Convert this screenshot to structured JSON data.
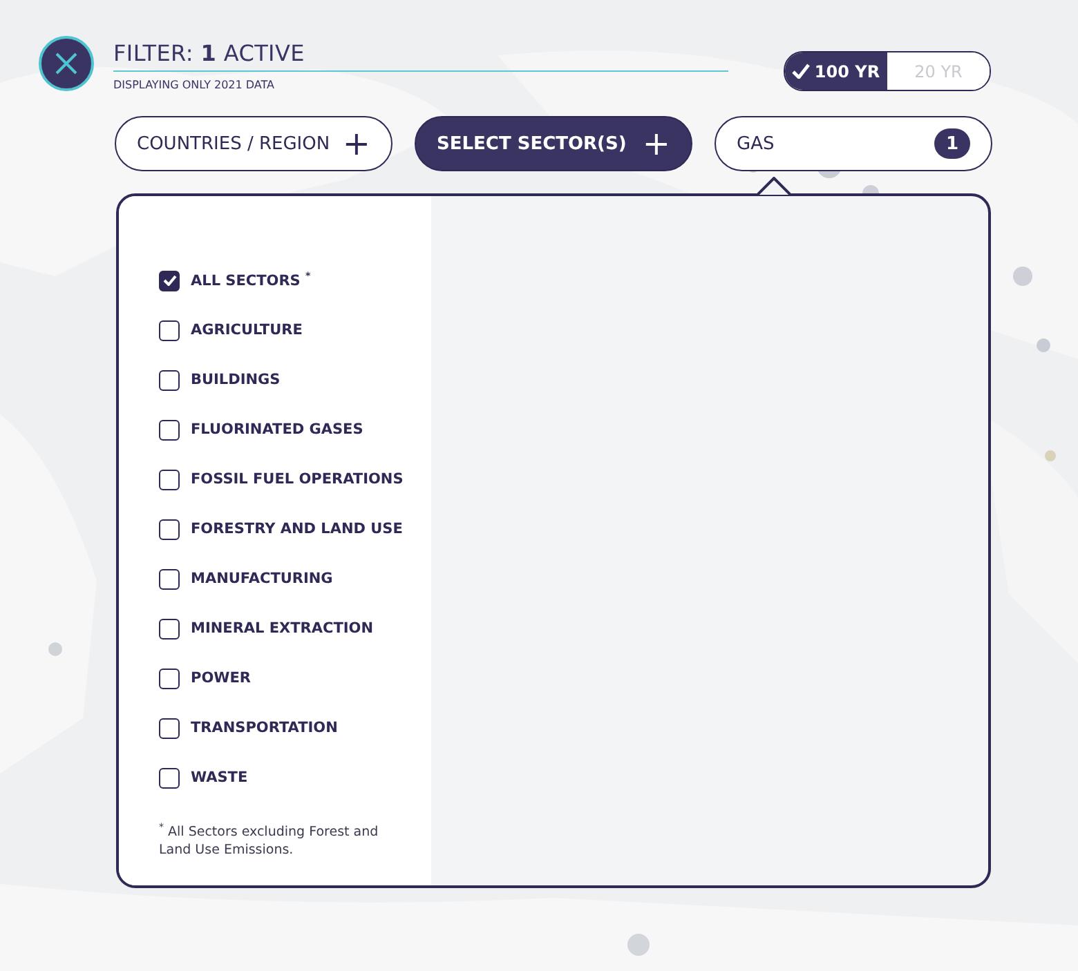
{
  "header": {
    "title": "FILTER: **1** ACTIVE",
    "subtitle": "DISPLAYING ONLY 2021 DATA"
  },
  "period_toggle": [
    {
      "label": "100 YR",
      "selected": true
    },
    {
      "label": "20 YR",
      "selected": false
    }
  ],
  "filters": [
    {
      "kind": "add",
      "label": "COUNTRIES / REGION",
      "selected": false,
      "icon": "+"
    },
    {
      "kind": "add",
      "label": "SELECT SECTOR(S)",
      "selected": true,
      "icon": "+"
    },
    {
      "kind": "count",
      "label": "GAS",
      "selected": false,
      "count": "1"
    }
  ],
  "sectors": [
    {
      "label": "ALL SECTORS $^{*}$",
      "checked": true
    },
    {
      "label": "AGRICULTURE",
      "checked": false
    },
    {
      "label": "BUILDINGS",
      "checked": false
    },
    {
      "label": "FLUORINATED GASES",
      "checked": false
    },
    {
      "label": "FOSSIL FUEL OPERATIONS",
      "checked": false
    },
    {
      "label": "FORESTRY AND LAND USE",
      "checked": false
    },
    {
      "label": "MANUFACTURING",
      "checked": false
    },
    {
      "label": "MINERAL EXTRACTION",
      "checked": false
    },
    {
      "label": "POWER",
      "checked": false
    },
    {
      "label": "TRANSPORTATION",
      "checked": false
    },
    {
      "label": "WASTE",
      "checked": false
    }
  ],
  "footnote": "$^{*}$ All Sectors excluding Forest and Land Use Emissions."
}
